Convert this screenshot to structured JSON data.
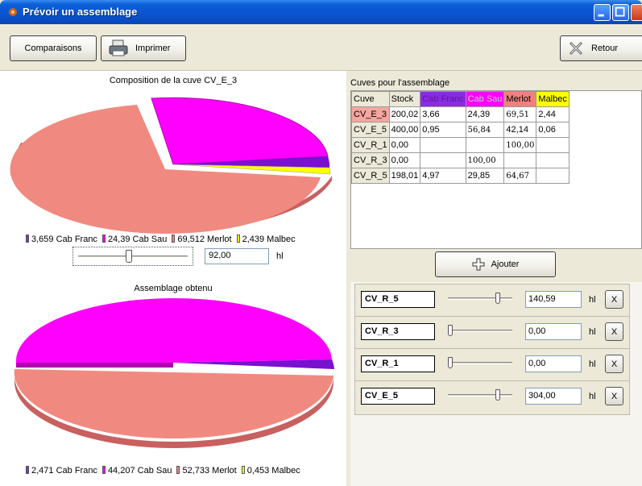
{
  "window": {
    "title": "Prévoir un assemblage"
  },
  "toolbar": {
    "comparaisons_label": "Comparaisons",
    "imprimer_label": "Imprimer",
    "retour_label": "Retour"
  },
  "composition": {
    "title": "Composition de la cuve CV_E_3",
    "legend": [
      {
        "text": "3,659 Cab Franc",
        "color": "#8a2be2"
      },
      {
        "text": "24,39 Cab Sau",
        "color": "#ff00ff"
      },
      {
        "text": "69,512 Merlot",
        "color": "#f08080"
      },
      {
        "text": "2,439 Malbec",
        "color": "#ffff00"
      }
    ],
    "volume": "92,00",
    "slider_level": 0.45,
    "unit": "hl"
  },
  "assemblage": {
    "title": "Assemblage obtenu",
    "legend": [
      {
        "text": "2,471 Cab Franc",
        "color": "#8a2be2"
      },
      {
        "text": "44,207 Cab Sau",
        "color": "#ff00ff"
      },
      {
        "text": "52,733 Merlot",
        "color": "#f08080"
      },
      {
        "text": "0,453 Malbec",
        "color": "#ffff00"
      }
    ]
  },
  "cuves_table": {
    "label": "Cuves pour l'assemblage",
    "headers": [
      {
        "text": "Cuve",
        "bg": "#ece9d8",
        "color": "#000"
      },
      {
        "text": "Stock",
        "bg": "#ece9d8",
        "color": "#000"
      },
      {
        "text": "Cab Franc",
        "bg": "#8a2be2",
        "color": "#5a1a9a"
      },
      {
        "text": "Cab Sau",
        "bg": "#ff00ff",
        "color": "#c8c8c8"
      },
      {
        "text": "Merlot",
        "bg": "#f08080",
        "color": "#000"
      },
      {
        "text": "Malbec",
        "bg": "#ffff00",
        "color": "#000"
      }
    ],
    "rows": [
      {
        "cells": [
          "CV_E_3",
          "200,02",
          "3,66",
          "24,39",
          "69,51",
          "2,44"
        ],
        "highlight": true,
        "bold": [
          4
        ]
      },
      {
        "cells": [
          "CV_E_5",
          "400,00",
          "0,95",
          "56,84",
          "42,14",
          "0,06"
        ],
        "highlight": false,
        "bold": [
          3
        ]
      },
      {
        "cells": [
          "CV_R_1",
          "0,00",
          "",
          "",
          "100,00",
          ""
        ],
        "highlight": false,
        "bold": [
          4
        ]
      },
      {
        "cells": [
          "CV_R_3",
          "0,00",
          "",
          "100,00",
          "",
          ""
        ],
        "highlight": false,
        "bold": [
          3
        ]
      },
      {
        "cells": [
          "CV_R_5",
          "198,01",
          "4,97",
          "29,85",
          "64,67",
          ""
        ],
        "highlight": false,
        "bold": [
          4
        ]
      }
    ]
  },
  "ajouter_label": "Ajouter",
  "assemblage_rows": [
    {
      "name": "CV_R_5",
      "value": "140,59",
      "unit": "hl",
      "remove": "X",
      "level": 0.8
    },
    {
      "name": "CV_R_3",
      "value": "0,00",
      "unit": "hl",
      "remove": "X",
      "level": 0.0
    },
    {
      "name": "CV_R_1",
      "value": "0,00",
      "unit": "hl",
      "remove": "X",
      "level": 0.0
    },
    {
      "name": "CV_E_5",
      "value": "304,00",
      "unit": "hl",
      "remove": "X",
      "level": 0.8
    }
  ]
}
